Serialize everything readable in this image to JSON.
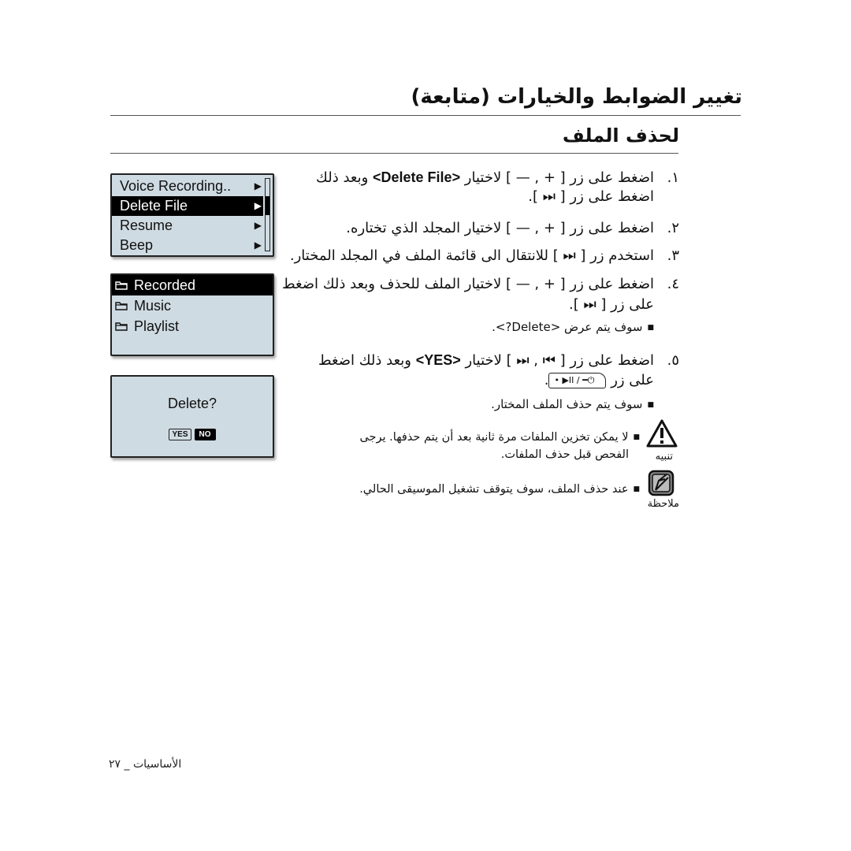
{
  "header": {
    "title": "تغيير الضوابط والخيارات (متابعة)",
    "section_title": "لحذف الملف"
  },
  "screens": {
    "menu": {
      "items": [
        {
          "label": "Voice Recording..",
          "selected": false
        },
        {
          "label": "Delete File",
          "selected": true
        },
        {
          "label": "Resume",
          "selected": false
        },
        {
          "label": "Beep",
          "selected": false
        }
      ],
      "arrow_icon": "▶"
    },
    "folders": {
      "items": [
        {
          "label": "Recorded",
          "selected": true
        },
        {
          "label": "Music",
          "selected": false
        },
        {
          "label": "Playlist",
          "selected": false
        }
      ]
    },
    "dialog": {
      "prompt": "Delete?",
      "yes_label": "YES",
      "no_label": "NO",
      "selected": "NO"
    }
  },
  "steps": [
    {
      "number": "١.",
      "line1_pre": "اضغط على زر [ + , — ] لاختيار ",
      "line1_key": "<Delete File>",
      "line1_post": " وبعد ذلك",
      "line2": "اضغط على زر [ ⏭ ]."
    },
    {
      "number": "٢.",
      "text": "اضغط على زر [ + , — ] لاختيار المجلد الذي تختاره."
    },
    {
      "number": "٣.",
      "text": "استخدم زر [ ⏭ ] للانتقال الى قائمة الملف في المجلد المختار."
    },
    {
      "number": "٤.",
      "line1": "اضغط على زر [ + , — ] لاختيار الملف للحذف وبعد ذلك اضغط",
      "line2": "على زر [ ⏭ ].",
      "bullet": "سوف يتم عرض <Delete?>."
    },
    {
      "number": "٥.",
      "line1_pre": "اضغط على زر [ ⏮ , ⏭ ] لاختيار ",
      "line1_key": "<YES>",
      "line1_post": " وبعد ذلك اضغط",
      "line2": "على زر",
      "button_key": "• ▶II / ━⏻",
      "line2_end": ".",
      "bullet": "سوف يتم حذف الملف المختار."
    }
  ],
  "notices": {
    "warning": {
      "icon": "warning-triangle-icon",
      "label": "تنبيه",
      "line1": "لا يمكن تخزين الملفات مرة ثانية بعد أن يتم حذفها. يرجى",
      "line2": "الفحص قبل حذف الملفات."
    },
    "note": {
      "icon": "pen-note-icon",
      "label": "ملاحظة",
      "line1": "عند حذف الملف، سوف يتوقف تشغيل الموسيقى الحالي."
    }
  },
  "footer": {
    "section": "الأساسيات",
    "page": "٢٧"
  }
}
